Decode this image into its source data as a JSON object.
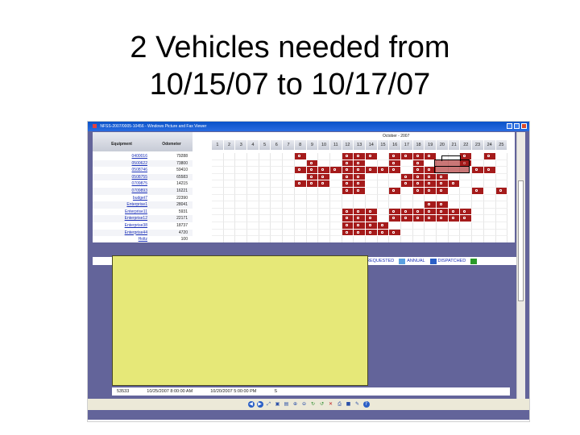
{
  "slide": {
    "title_line1": "2 Vehicles needed from",
    "title_line2": "10/15/07 to 10/17/07"
  },
  "window": {
    "title": "NFSS-2007/0005-10456 - Windows Picture and Fax Viewer"
  },
  "table": {
    "headers": {
      "equipment": "Equipment",
      "odometer": "Odometer"
    },
    "rows": [
      {
        "equipment": "0400016",
        "odometer": "79288"
      },
      {
        "equipment": "0500622",
        "odometer": "73800"
      },
      {
        "equipment": "0508746",
        "odometer": "59410"
      },
      {
        "equipment": "0508755",
        "odometer": "65583"
      },
      {
        "equipment": "0709875",
        "odometer": "14215"
      },
      {
        "equipment": "0709893",
        "odometer": "16221"
      },
      {
        "equipment": "budget7",
        "odometer": "22390"
      },
      {
        "equipment": "Enterprise1",
        "odometer": "28041"
      },
      {
        "equipment": "Enterprise11",
        "odometer": "5931"
      },
      {
        "equipment": "Enterprise12",
        "odometer": "22171"
      },
      {
        "equipment": "Enterprise38",
        "odometer": "18737"
      },
      {
        "equipment": "Enterprise44",
        "odometer": "4720"
      },
      {
        "equipment": "Holtz",
        "odometer": "100"
      }
    ]
  },
  "calendar": {
    "month": "October - 2007",
    "days": [
      "1",
      "2",
      "3",
      "4",
      "5",
      "6",
      "7",
      "8",
      "9",
      "10",
      "11",
      "12",
      "13",
      "14",
      "15",
      "16",
      "17",
      "18",
      "19",
      "20",
      "21",
      "22",
      "23",
      "24",
      "25"
    ],
    "reservations": [
      [
        8,
        12,
        13,
        14,
        16,
        17,
        18,
        19,
        22,
        24
      ],
      [
        9,
        12,
        13,
        16,
        18,
        22
      ],
      [
        8,
        9,
        10,
        11,
        12,
        13,
        14,
        15,
        16,
        18,
        19,
        23,
        24
      ],
      [
        9,
        10,
        12,
        13,
        17,
        18,
        19,
        20
      ],
      [
        8,
        9,
        10,
        12,
        13,
        17,
        18,
        19,
        20,
        21
      ],
      [
        12,
        13,
        16,
        18,
        19,
        20,
        23,
        25
      ],
      [],
      [
        19,
        20
      ],
      [
        12,
        13,
        14,
        16,
        17,
        18,
        19,
        20,
        21,
        22
      ],
      [
        12,
        13,
        14,
        16,
        17,
        18,
        19,
        20,
        21,
        22
      ],
      [
        12,
        13,
        14,
        15
      ],
      [
        12,
        13,
        14,
        15,
        16
      ],
      []
    ]
  },
  "legend": {
    "requested": "REQUESTED",
    "annual": "ANNUAL",
    "dispatched": "DISPATCHED",
    "colors": {
      "annual": "#5aa0e0",
      "dispatched": "#2b5fc6",
      "next": "#2a9a2a"
    }
  },
  "list": {
    "id": "53533",
    "start": "10/25/2007 8:00:00 AM",
    "end": "10/20/2007 5:00:00 PM",
    "code": "S"
  },
  "toolbar": {
    "icons": [
      "previous-icon",
      "next-icon",
      "best-fit-icon",
      "actual-size-icon",
      "slideshow-icon",
      "zoom-in-icon",
      "zoom-out-icon",
      "rotate-clockwise-icon",
      "rotate-counterclockwise-icon",
      "delete-icon",
      "print-icon",
      "save-icon",
      "edit-icon",
      "help-icon"
    ]
  }
}
